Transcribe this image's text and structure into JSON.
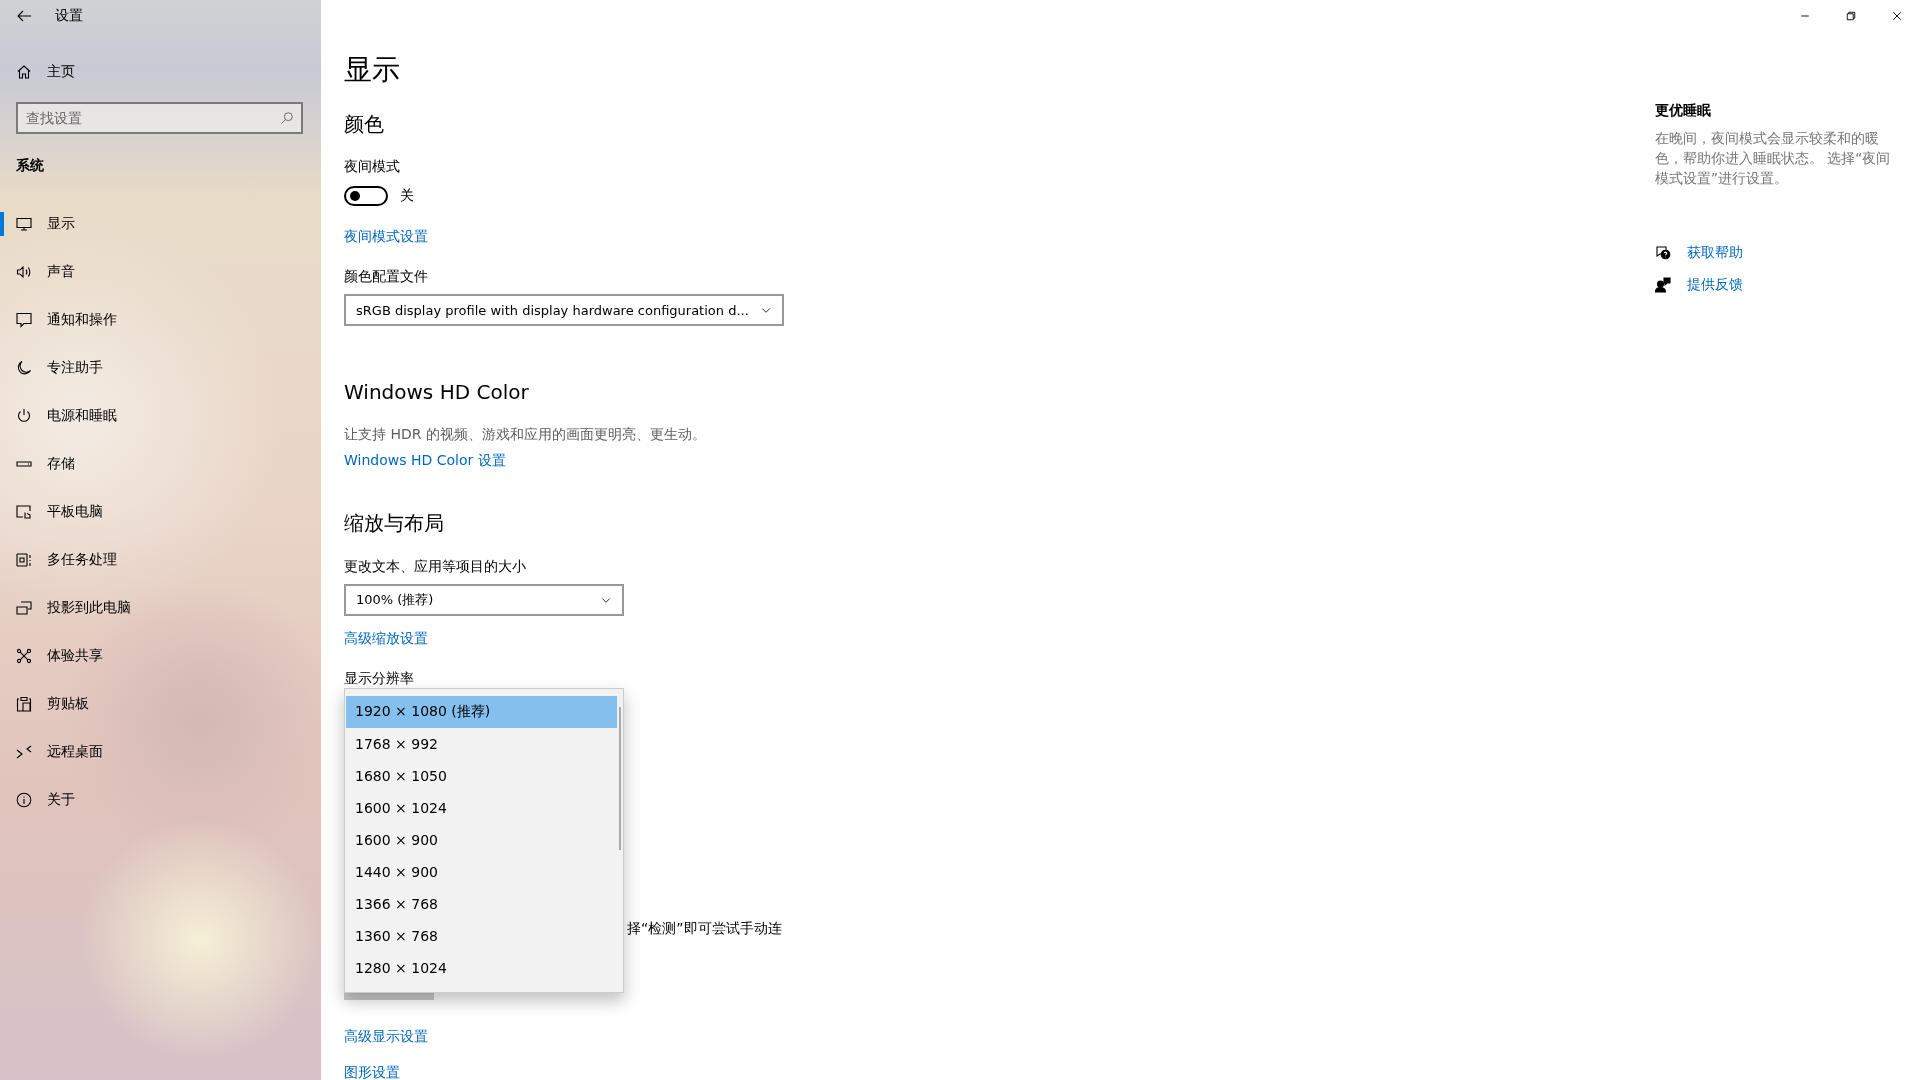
{
  "window": {
    "title": "设置"
  },
  "sidebar": {
    "home": "主页",
    "search": {
      "placeholder": "查找设置"
    },
    "section": "系统",
    "items": [
      {
        "label": "显示",
        "selected": true
      },
      {
        "label": "声音",
        "selected": false
      },
      {
        "label": "通知和操作",
        "selected": false
      },
      {
        "label": "专注助手",
        "selected": false
      },
      {
        "label": "电源和睡眠",
        "selected": false
      },
      {
        "label": "存储",
        "selected": false
      },
      {
        "label": "平板电脑",
        "selected": false
      },
      {
        "label": "多任务处理",
        "selected": false
      },
      {
        "label": "投影到此电脑",
        "selected": false
      },
      {
        "label": "体验共享",
        "selected": false
      },
      {
        "label": "剪贴板",
        "selected": false
      },
      {
        "label": "远程桌面",
        "selected": false
      },
      {
        "label": "关于",
        "selected": false
      }
    ]
  },
  "page_title": "显示",
  "color": {
    "heading": "颜色",
    "night_light": {
      "label": "夜间模式",
      "on": false,
      "state_text": "关"
    },
    "night_light_link": "夜间模式设置",
    "profile": {
      "label": "颜色配置文件",
      "value": "sRGB display profile with display hardware configuration d..."
    }
  },
  "hd_color": {
    "heading": "Windows HD Color",
    "description": "让支持 HDR 的视频、游戏和应用的画面更明亮、更生动。",
    "link": "Windows HD Color 设置"
  },
  "scale_layout": {
    "heading": "缩放与布局",
    "scale": {
      "label": "更改文本、应用等项目的大小",
      "value": "100% (推荐)"
    },
    "advanced_scaling_link": "高级缩放设置",
    "resolution": {
      "label": "显示分辨率",
      "expanded": true,
      "options": [
        {
          "label": "1920 × 1080 (推荐)",
          "selected": true
        },
        {
          "label": "1768 × 992",
          "selected": false
        },
        {
          "label": "1680 × 1050",
          "selected": false
        },
        {
          "label": "1600 × 1024",
          "selected": false
        },
        {
          "label": "1600 × 900",
          "selected": false
        },
        {
          "label": "1440 × 900",
          "selected": false
        },
        {
          "label": "1366 × 768",
          "selected": false
        },
        {
          "label": "1360 × 768",
          "selected": false
        },
        {
          "label": "1280 × 1024",
          "selected": false
        }
      ]
    },
    "detect_hint": "择“检测”即可尝试手动连",
    "advanced_display_link": "高级显示设置",
    "graphics_link": "图形设置"
  },
  "side_panel": {
    "heading": "更优睡眠",
    "text": "在晚间，夜间模式会显示较柔和的暖色，帮助你进入睡眠状态。 选择“夜间模式设置”进行设置。",
    "links": [
      {
        "label": "获取帮助"
      },
      {
        "label": "提供反馈"
      }
    ]
  }
}
